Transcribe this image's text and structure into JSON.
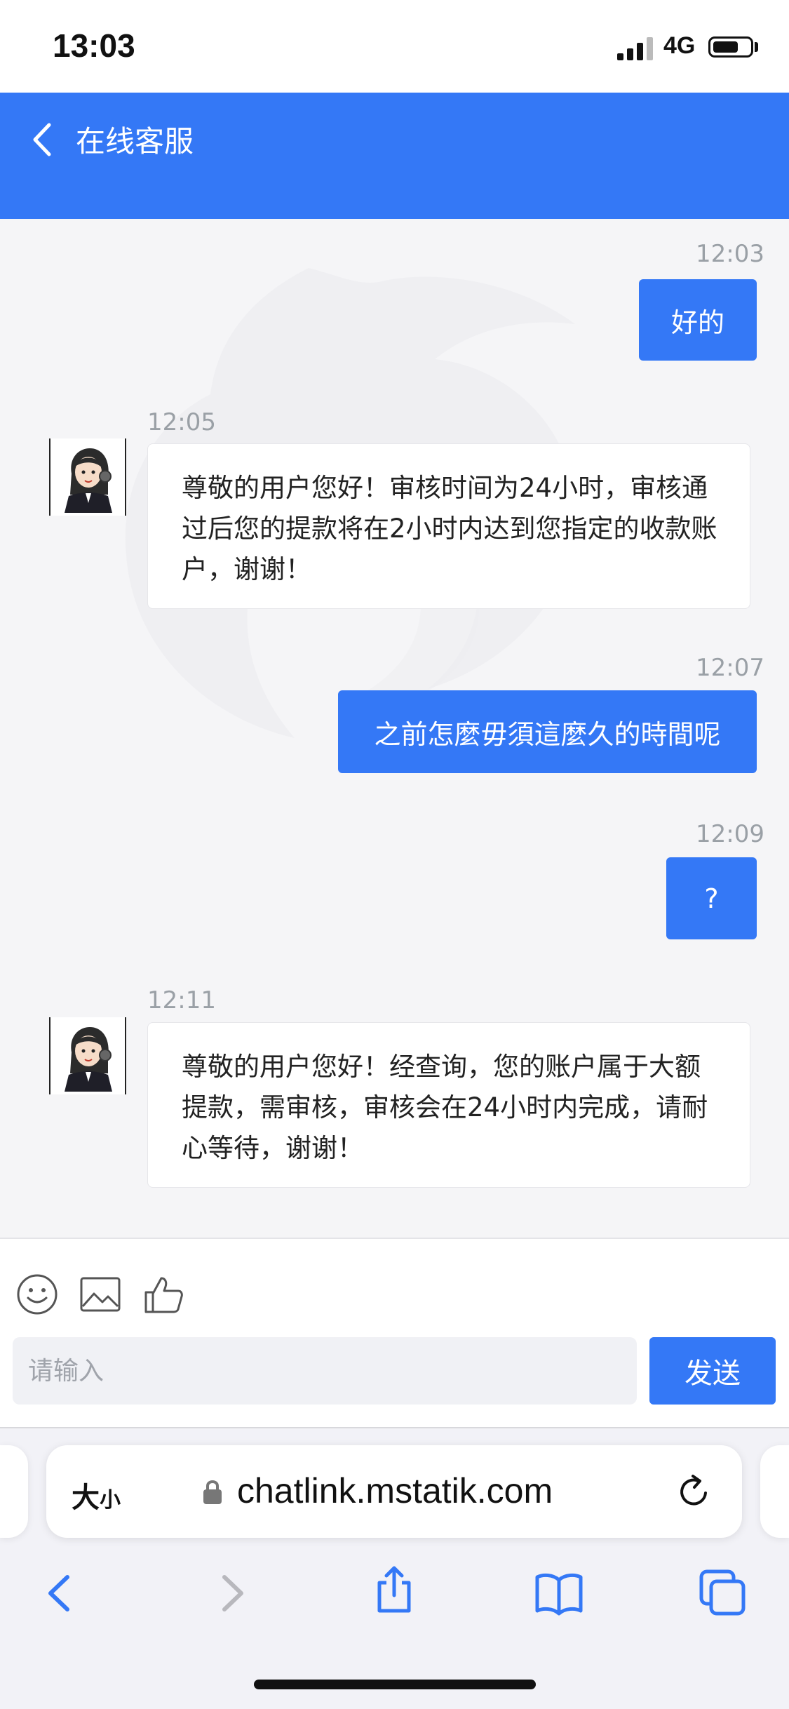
{
  "status_bar": {
    "time": "13:03",
    "network": "4G",
    "battery_level": 0.7
  },
  "header": {
    "title": "在线客服"
  },
  "messages": [
    {
      "direction": "out",
      "time": "12:03",
      "text": "好的"
    },
    {
      "direction": "in",
      "time": "12:05",
      "text": "尊敬的用户您好！审核时间为24小时，审核通过后您的提款将在2小时内达到您指定的收款账户，谢谢！"
    },
    {
      "direction": "out",
      "time": "12:07",
      "text": "之前怎麼毋須這麼久的時間呢"
    },
    {
      "direction": "out",
      "time": "12:09",
      "text": "?"
    },
    {
      "direction": "in",
      "time": "12:11",
      "text": "尊敬的用户您好！经查询，您的账户属于大额提款，需审核，审核会在24小时内完成，请耐心等待，谢谢！"
    }
  ],
  "composer": {
    "tools": [
      "emoji-icon",
      "image-icon",
      "thumbs-up-icon"
    ],
    "input_placeholder": "请输入",
    "input_value": "",
    "send_label": "发送"
  },
  "browser": {
    "text_size_large": "大",
    "text_size_small": "小",
    "url": "chatlink.mstatik.com"
  },
  "colors": {
    "brand": "#3478f6",
    "background": "#f5f5f7",
    "timestamp": "#9aa0a6"
  }
}
